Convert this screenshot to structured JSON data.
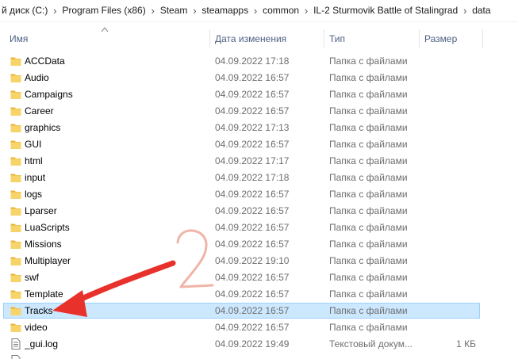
{
  "breadcrumb": [
    "й диск (C:)",
    "Program Files (x86)",
    "Steam",
    "steamapps",
    "common",
    "IL-2 Sturmovik Battle of Stalingrad",
    "data"
  ],
  "columns": {
    "name": "Имя",
    "date": "Дата изменения",
    "type": "Тип",
    "size": "Размер"
  },
  "sort": {
    "column": "name",
    "direction": "ascending"
  },
  "files": [
    {
      "name": "ACCData",
      "date": "04.09.2022 17:18",
      "type": "Папка с файлами",
      "size": "",
      "icon": "folder-icon"
    },
    {
      "name": "Audio",
      "date": "04.09.2022 16:57",
      "type": "Папка с файлами",
      "size": "",
      "icon": "folder-icon"
    },
    {
      "name": "Campaigns",
      "date": "04.09.2022 16:57",
      "type": "Папка с файлами",
      "size": "",
      "icon": "folder-icon"
    },
    {
      "name": "Career",
      "date": "04.09.2022 16:57",
      "type": "Папка с файлами",
      "size": "",
      "icon": "folder-icon"
    },
    {
      "name": "graphics",
      "date": "04.09.2022 17:13",
      "type": "Папка с файлами",
      "size": "",
      "icon": "folder-icon"
    },
    {
      "name": "GUI",
      "date": "04.09.2022 16:57",
      "type": "Папка с файлами",
      "size": "",
      "icon": "folder-icon"
    },
    {
      "name": "html",
      "date": "04.09.2022 17:17",
      "type": "Папка с файлами",
      "size": "",
      "icon": "folder-icon"
    },
    {
      "name": "input",
      "date": "04.09.2022 17:18",
      "type": "Папка с файлами",
      "size": "",
      "icon": "folder-icon"
    },
    {
      "name": "logs",
      "date": "04.09.2022 16:57",
      "type": "Папка с файлами",
      "size": "",
      "icon": "folder-icon"
    },
    {
      "name": "Lparser",
      "date": "04.09.2022 16:57",
      "type": "Папка с файлами",
      "size": "",
      "icon": "folder-icon"
    },
    {
      "name": "LuaScripts",
      "date": "04.09.2022 16:57",
      "type": "Папка с файлами",
      "size": "",
      "icon": "folder-icon"
    },
    {
      "name": "Missions",
      "date": "04.09.2022 16:57",
      "type": "Папка с файлами",
      "size": "",
      "icon": "folder-icon"
    },
    {
      "name": "Multiplayer",
      "date": "04.09.2022 19:10",
      "type": "Папка с файлами",
      "size": "",
      "icon": "folder-icon"
    },
    {
      "name": "swf",
      "date": "04.09.2022 16:57",
      "type": "Папка с файлами",
      "size": "",
      "icon": "folder-icon"
    },
    {
      "name": "Template",
      "date": "04.09.2022 16:57",
      "type": "Папка с файлами",
      "size": "",
      "icon": "folder-icon"
    },
    {
      "name": "Tracks",
      "date": "04.09.2022 16:57",
      "type": "Папка с файлами",
      "size": "",
      "icon": "folder-icon",
      "selected": true
    },
    {
      "name": "video",
      "date": "04.09.2022 16:57",
      "type": "Папка с файлами",
      "size": "",
      "icon": "folder-icon"
    },
    {
      "name": "_gui.log",
      "date": "04.09.2022 19:49",
      "type": "Текстовый докум...",
      "size": "1 КБ",
      "icon": "text-file-icon"
    },
    {
      "name": "",
      "date": "",
      "type": "",
      "size": "",
      "icon": "file-icon"
    }
  ],
  "annotation": {
    "label": "2",
    "color": "#e8312a",
    "label_color": "#f0b4a8"
  },
  "colors": {
    "selection_bg": "#cce8ff",
    "selection_border": "#99d1ff",
    "header_text": "#4d6082",
    "folder": "#f2c94c"
  }
}
